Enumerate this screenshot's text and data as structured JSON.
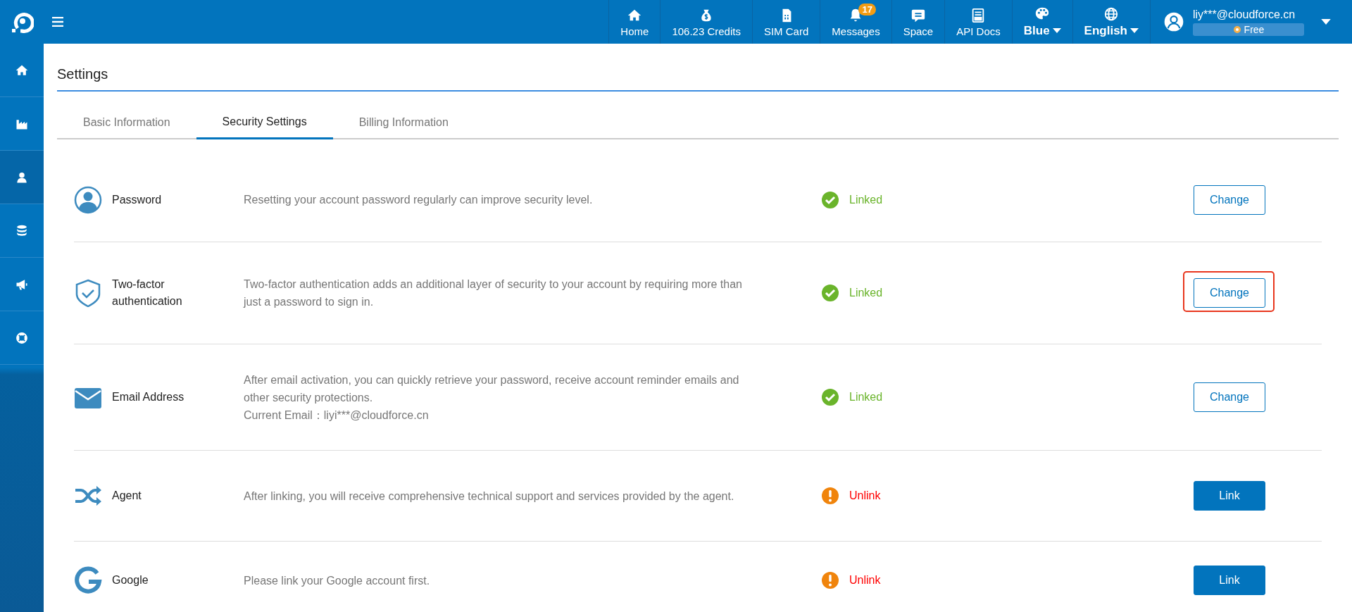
{
  "topbar": {
    "nav": [
      {
        "kind": "link",
        "label": "Home"
      },
      {
        "kind": "link",
        "label": "106.23 Credits"
      },
      {
        "kind": "link",
        "label": "SIM Card"
      },
      {
        "kind": "link",
        "label": "Messages",
        "badge": "17"
      },
      {
        "kind": "link",
        "label": "Space"
      },
      {
        "kind": "link",
        "label": "API Docs"
      },
      {
        "kind": "dropdown",
        "label": "Blue"
      },
      {
        "kind": "dropdown",
        "label": "English"
      }
    ],
    "user": {
      "email": "liy***@cloudforce.cn",
      "plan": "Free"
    }
  },
  "sidebar": {
    "items": [
      {
        "selected": false
      },
      {
        "selected": false
      },
      {
        "selected": true
      },
      {
        "selected": false
      },
      {
        "selected": false
      },
      {
        "selected": false
      }
    ]
  },
  "page": {
    "title": "Settings"
  },
  "tabs": [
    {
      "label": "Basic Information",
      "selected": false
    },
    {
      "label": "Security Settings",
      "selected": true
    },
    {
      "label": "Billing Information",
      "selected": false
    }
  ],
  "rows": [
    {
      "label": "Password",
      "description": [
        "Resetting your account password regularly can improve security level."
      ],
      "linked": true,
      "status_text": "Linked",
      "action": "Change",
      "highlighted": false
    },
    {
      "label": "Two-factor authentication",
      "description": [
        "Two-factor authentication adds an additional layer of security to your account by requiring more than just a password to sign in."
      ],
      "linked": true,
      "status_text": "Linked",
      "action": "Change",
      "highlighted": true
    },
    {
      "label": "Email Address",
      "description": [
        "After email activation, you can quickly retrieve your password, receive account reminder emails and other security protections.",
        "Current Email：liyi***@cloudforce.cn"
      ],
      "linked": true,
      "status_text": "Linked",
      "action": "Change",
      "highlighted": false
    },
    {
      "label": "Agent",
      "description": [
        "After linking, you will receive comprehensive technical support and services provided by the agent."
      ],
      "linked": false,
      "status_text": "Unlink",
      "action": "Link",
      "highlighted": false
    },
    {
      "label": "Google",
      "description": [
        "Please link your Google account first."
      ],
      "linked": false,
      "status_text": "Unlink",
      "action": "Link",
      "highlighted": false
    }
  ]
}
